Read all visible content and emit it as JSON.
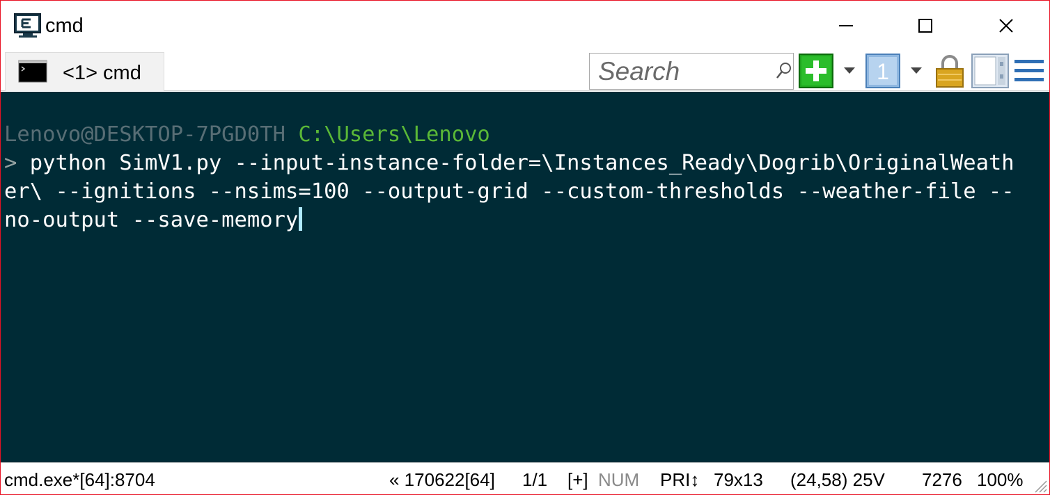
{
  "window": {
    "title": "cmd",
    "controls": {
      "minimize": "minimize-icon",
      "maximize": "maximize-icon",
      "close": "close-icon"
    }
  },
  "tabs": [
    {
      "label": "<1> cmd",
      "icon": "console-icon"
    }
  ],
  "toolbar": {
    "search_placeholder": "Search",
    "buttons": [
      "new-console-icon",
      "dropdown-icon",
      "buffer-icon",
      "dropdown-icon",
      "lock-icon",
      "panel-icon",
      "hamburger-menu-icon"
    ]
  },
  "console": {
    "host": "Lenovo@DESKTOP-7PGD0TH",
    "path": "C:\\Users\\Lenovo",
    "prompt": ">",
    "lines": [
      " python SimV1.py --input-instance-folder=\\Instances_Ready\\Dogrib\\OriginalWeath",
      "er\\ --ignitions --nsims=100 --output-grid --custom-thresholds --weather-file --",
      "no-output --save-memory"
    ]
  },
  "status": {
    "process": "cmd.exe*[64]:8704",
    "buffer": "« 170622[64]",
    "position": "1/1",
    "plus": "[+]",
    "num": "NUM",
    "pri": "PRI↕",
    "size": "79x13",
    "coords": "(24,58) 25V",
    "pid": "7276",
    "zoom": "100%"
  },
  "colors": {
    "console_bg": "#002b36",
    "host": "#586e75",
    "path": "#5ab837",
    "text": "#ffffff",
    "window_border": "#e81123"
  }
}
